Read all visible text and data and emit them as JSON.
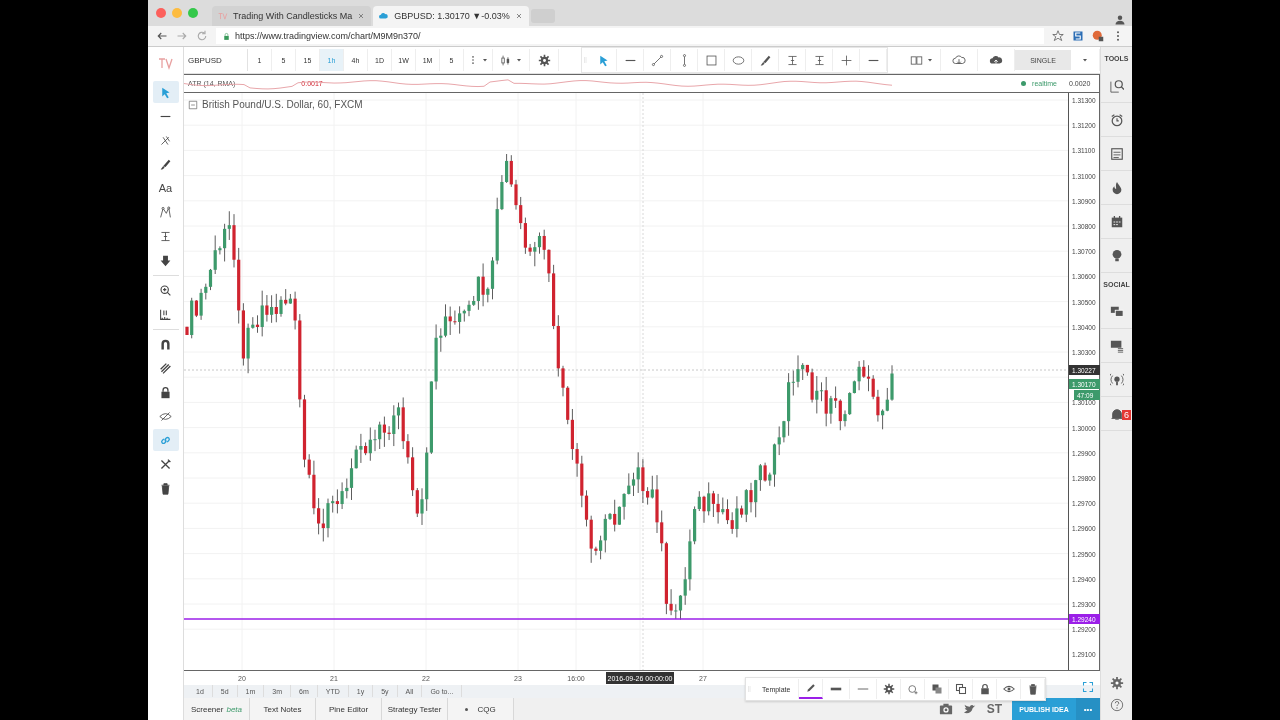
{
  "browser": {
    "tabs": [
      {
        "title": "Trading With Candlesticks Ma",
        "selected": false
      },
      {
        "title": "GBPUSD: 1.30170 ▼-0.03%",
        "selected": true
      }
    ],
    "url": "https://www.tradingview.com/chart/M9M9n370/"
  },
  "toolbar": {
    "symbol": "GBPUSD",
    "intervals": [
      {
        "label": "1",
        "selected": false
      },
      {
        "label": "5",
        "selected": false
      },
      {
        "label": "15",
        "selected": false
      },
      {
        "label": "1h",
        "selected": true
      },
      {
        "label": "4h",
        "selected": false
      },
      {
        "label": "1D",
        "selected": false
      },
      {
        "label": "1W",
        "selected": false
      },
      {
        "label": "1M",
        "selected": false
      },
      {
        "label": "5",
        "selected": false
      }
    ],
    "layout": "SINGLE"
  },
  "left_tools": [
    {
      "selected": true
    },
    {
      "selected": false
    },
    {
      "selected": false
    },
    {
      "selected": false
    },
    {
      "label": "Aa",
      "selected": false
    },
    {
      "selected": false
    },
    {
      "selected": false
    },
    {
      "selected": false
    },
    {
      "selected": false
    },
    {
      "selected": false
    },
    {
      "selected": false
    },
    {
      "selected": false
    },
    {
      "selected": false
    },
    {
      "selected": false
    },
    {
      "selected": true
    },
    {
      "selected": false
    },
    {
      "selected": false
    }
  ],
  "indicator": {
    "name": "ATR (14, RMA)",
    "value": "0.0017",
    "status": "realtime",
    "axis_value": "0.0020"
  },
  "chart": {
    "title": "British Pound/U.S. Dollar, 60, FXCM",
    "price_ticks": [
      "1.31300",
      "1.31200",
      "1.31100",
      "1.31000",
      "1.30900",
      "1.30800",
      "1.30700",
      "1.30600",
      "1.30500",
      "1.30400",
      "1.30300",
      "1.30100",
      "1.30000",
      "1.29900",
      "1.29800",
      "1.29700",
      "1.29600",
      "1.29500",
      "1.29400",
      "1.29300",
      "1.29200",
      "1.29100"
    ],
    "price_tags": [
      {
        "text": "1.30227",
        "kind": "crosshair"
      },
      {
        "text": "1.30170",
        "kind": "last"
      },
      {
        "text": "47:09",
        "kind": "countdown"
      },
      {
        "text": "1.29240",
        "kind": "line"
      }
    ],
    "time_labels": [
      {
        "text": "20",
        "kind": "tick"
      },
      {
        "text": "21",
        "kind": "tick"
      },
      {
        "text": "22",
        "kind": "tick"
      },
      {
        "text": "23",
        "kind": "tick"
      },
      {
        "text": "16:00",
        "kind": "tick"
      },
      {
        "text": "2016-09-26 00:00:00",
        "kind": "crosshair"
      },
      {
        "text": "27",
        "kind": "tick"
      }
    ]
  },
  "ranges": [
    "1d",
    "5d",
    "1m",
    "3m",
    "6m",
    "YTD",
    "1y",
    "5y",
    "All",
    "Go to..."
  ],
  "floating_toolbar": {
    "template": "Template"
  },
  "bottom_tabs": [
    {
      "label": "Screener",
      "badge": "beta",
      "kind": "tab"
    },
    {
      "label": "Text Notes",
      "kind": "tab"
    },
    {
      "label": "Pine Editor",
      "kind": "tab"
    },
    {
      "label": "Strategy Tester",
      "kind": "tab"
    },
    {
      "label": "CQG",
      "kind": "connection"
    }
  ],
  "publish": {
    "share_text": "ST",
    "button": "PUBLISH IDEA",
    "more": "•••"
  },
  "right_sidebar": {
    "tools_label": "TOOLS",
    "social_label": "SOCIAL",
    "notification_count": "6"
  }
}
